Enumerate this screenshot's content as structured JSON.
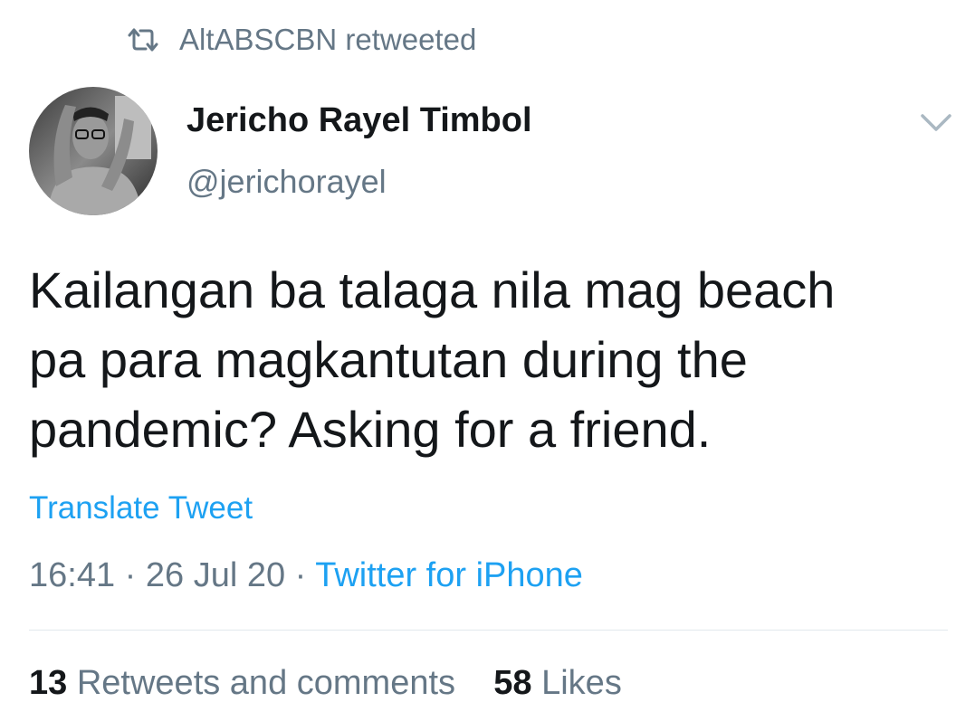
{
  "retweet_header": {
    "icon": "retweet-icon",
    "text": "AltABSCBN retweeted"
  },
  "author": {
    "name": "Jericho Rayel Timbol",
    "handle": "@jerichorayel",
    "avatar": "avatar-photo"
  },
  "menu_icon": "chevron-down-icon",
  "tweet": {
    "lines": [
      "Kailangan ba talaga nila mag beach",
      "pa para magkantutan during the",
      "pandemic? Asking for a friend."
    ],
    "translate_label": "Translate Tweet",
    "time": "16:41",
    "date": "26 Jul 20",
    "separator": "·",
    "source": "Twitter for iPhone"
  },
  "stats": {
    "retweets_count": "13",
    "retweets_label": "Retweets and comments",
    "likes_count": "58",
    "likes_label": "Likes"
  },
  "colors": {
    "accent": "#1da1f2",
    "muted": "#657786",
    "text": "#14171a",
    "divider": "#e1e8ed"
  }
}
